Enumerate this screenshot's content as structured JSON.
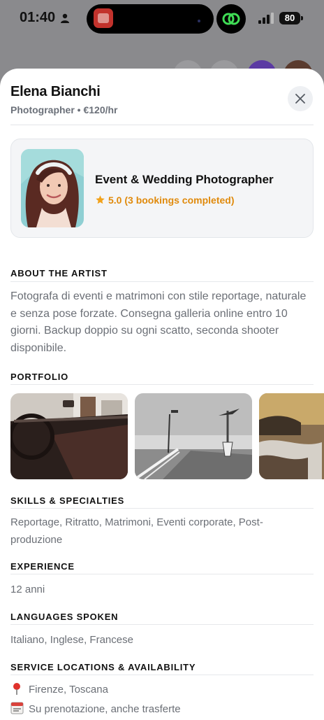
{
  "status_bar": {
    "time": "01:40",
    "battery": "80"
  },
  "artist": {
    "name": "Elena Bianchi",
    "subtitle": "Photographer • €120/hr",
    "headline": "Event & Wedding Photographer",
    "rating": "5.0 (3 bookings completed)"
  },
  "sections": {
    "about": {
      "title": "ABOUT THE ARTIST",
      "text": "Fotografa di eventi e matrimoni con stile reportage, naturale e senza pose forzate. Consegna galleria online entro 10 giorni. Backup doppio su ogni scatto, seconda shooter disponibile."
    },
    "portfolio": {
      "title": "PORTFOLIO",
      "photos": [
        "car-interior-photo",
        "pier-photo",
        "seascape-photo"
      ]
    },
    "skills": {
      "title": "SKILLS & SPECIALTIES",
      "text": "Reportage, Ritratto, Matrimoni, Eventi corporate, Post-produzione"
    },
    "experience": {
      "title": "EXPERIENCE",
      "text": "12 anni"
    },
    "languages": {
      "title": "LANGUAGES SPOKEN",
      "text": "Italiano, Inglese, Francese"
    },
    "locations": {
      "title": "SERVICE LOCATIONS & AVAILABILITY",
      "location": "Firenze, Toscana",
      "availability": "Su prenotazione, anche trasferte"
    }
  },
  "icons": {
    "close": "close-icon",
    "star": "star-icon",
    "pin": "map-pin-icon",
    "calendar": "calendar-icon"
  },
  "colors": {
    "rating_accent": "#e08a0c",
    "text_muted": "#6b6f76"
  }
}
